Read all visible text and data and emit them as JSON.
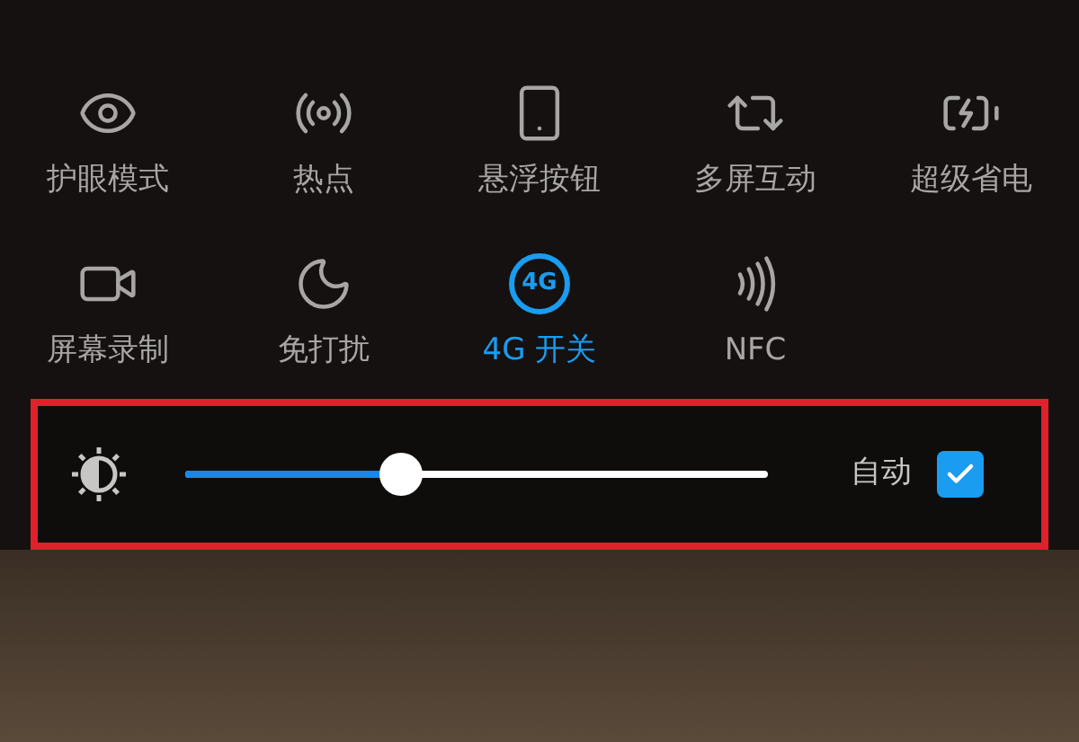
{
  "tiles": [
    {
      "label": "护眼模式",
      "on": false
    },
    {
      "label": "热点",
      "on": false
    },
    {
      "label": "悬浮按钮",
      "on": false
    },
    {
      "label": "多屏互动",
      "on": false
    },
    {
      "label": "超级省电",
      "on": false
    },
    {
      "label": "屏幕录制",
      "on": false
    },
    {
      "label": "免打扰",
      "on": false
    },
    {
      "label": "4G 开关",
      "on": true,
      "icon_text": "4G"
    },
    {
      "label": "NFC",
      "on": false
    }
  ],
  "brightness": {
    "level": 0.37,
    "auto_label": "自动",
    "auto_checked": true
  }
}
